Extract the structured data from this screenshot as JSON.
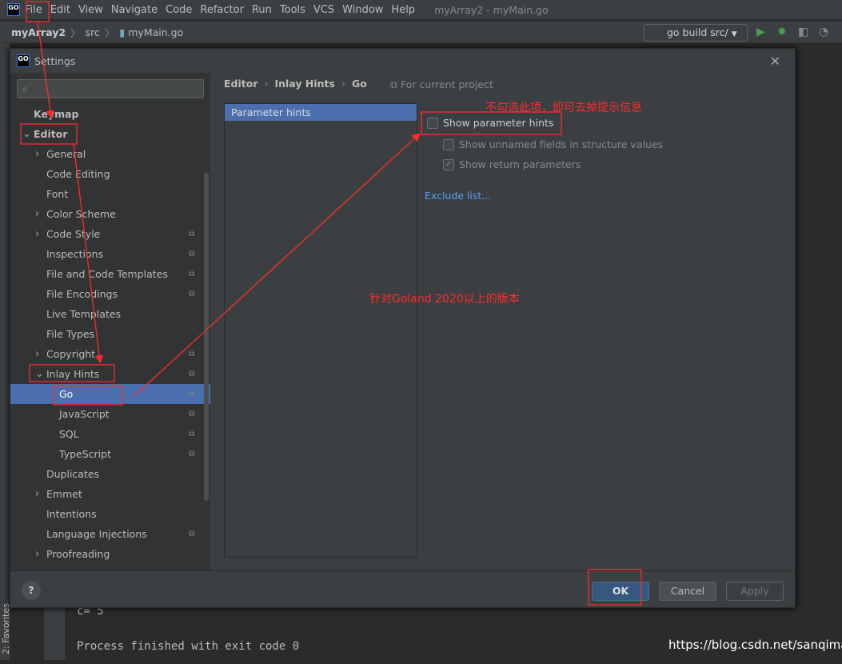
{
  "menubar": {
    "logo": "GO",
    "items": [
      "File",
      "Edit",
      "View",
      "Navigate",
      "Code",
      "Refactor",
      "Run",
      "Tools",
      "VCS",
      "Window",
      "Help"
    ],
    "window_title": "myArray2 - myMain.go"
  },
  "navbar": {
    "project": "myArray2",
    "folder": "src",
    "file": "myMain.go",
    "run_config": "go build src/"
  },
  "dialog": {
    "title": "Settings",
    "search_placeholder": "",
    "tree": [
      {
        "label": "Keymap",
        "level": 0,
        "bold": true
      },
      {
        "label": "Editor",
        "level": 0,
        "bold": true,
        "expanded": true
      },
      {
        "label": "General",
        "level": 1,
        "arrow": true
      },
      {
        "label": "Code Editing",
        "level": 1
      },
      {
        "label": "Font",
        "level": 1
      },
      {
        "label": "Color Scheme",
        "level": 1,
        "arrow": true
      },
      {
        "label": "Code Style",
        "level": 1,
        "arrow": true,
        "copy": true
      },
      {
        "label": "Inspections",
        "level": 1,
        "copy": true
      },
      {
        "label": "File and Code Templates",
        "level": 1,
        "copy": true
      },
      {
        "label": "File Encodings",
        "level": 1,
        "copy": true
      },
      {
        "label": "Live Templates",
        "level": 1
      },
      {
        "label": "File Types",
        "level": 1
      },
      {
        "label": "Copyright",
        "level": 1,
        "arrow": true,
        "copy": true
      },
      {
        "label": "Inlay Hints",
        "level": 1,
        "expanded": true,
        "copy": true
      },
      {
        "label": "Go",
        "level": 2,
        "copy": true,
        "selected": true
      },
      {
        "label": "JavaScript",
        "level": 2,
        "copy": true
      },
      {
        "label": "SQL",
        "level": 2,
        "copy": true
      },
      {
        "label": "TypeScript",
        "level": 2,
        "copy": true
      },
      {
        "label": "Duplicates",
        "level": 1
      },
      {
        "label": "Emmet",
        "level": 1,
        "arrow": true
      },
      {
        "label": "Intentions",
        "level": 1
      },
      {
        "label": "Language Injections",
        "level": 1,
        "copy": true
      },
      {
        "label": "Proofreading",
        "level": 1,
        "arrow": true
      }
    ],
    "breadcrumb": [
      "Editor",
      "Inlay Hints",
      "Go"
    ],
    "scope": "For current project",
    "hint_list": [
      "Parameter hints"
    ],
    "options": [
      {
        "label": "Show parameter hints",
        "checked": false,
        "enabled": true
      },
      {
        "label": "Show unnamed fields in structure values",
        "checked": false,
        "enabled": false
      },
      {
        "label": "Show return parameters",
        "checked": true,
        "enabled": false
      }
    ],
    "exclude_link": "Exclude list...",
    "buttons": {
      "help": "?",
      "ok": "OK",
      "cancel": "Cancel",
      "apply": "Apply"
    }
  },
  "console": {
    "line1": "c=  5",
    "line2": "Process finished with exit code 0",
    "side_tab": "2: Favorites"
  },
  "annotations": {
    "uncheck_note": "不勾选此项，即可去掉提示信息",
    "version_note": "针对Goland 2020以上的版本",
    "color": "#ff2a2a"
  },
  "watermark": "https://blog.csdn.net/sanqima"
}
